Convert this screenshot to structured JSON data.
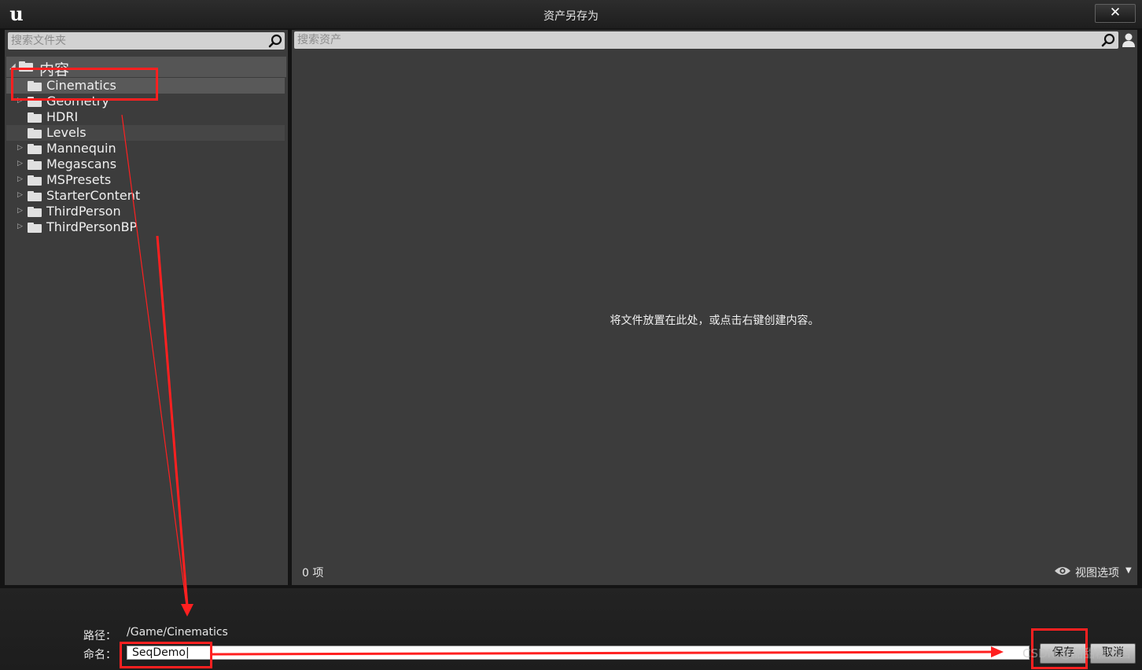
{
  "window": {
    "title": "资产另存为",
    "close_glyph": "✕",
    "logo_glyph": "u"
  },
  "left_panel": {
    "search_placeholder": "搜索文件夹",
    "root_label": "内容",
    "items": [
      {
        "label": "Cinematics",
        "has_children": false,
        "state": "selected"
      },
      {
        "label": "Geometry",
        "has_children": true,
        "state": "normal"
      },
      {
        "label": "HDRI",
        "has_children": false,
        "state": "normal"
      },
      {
        "label": "Levels",
        "has_children": false,
        "state": "hover"
      },
      {
        "label": "Mannequin",
        "has_children": true,
        "state": "normal"
      },
      {
        "label": "Megascans",
        "has_children": true,
        "state": "normal"
      },
      {
        "label": "MSPresets",
        "has_children": true,
        "state": "normal"
      },
      {
        "label": "StarterContent",
        "has_children": true,
        "state": "normal"
      },
      {
        "label": "ThirdPerson",
        "has_children": true,
        "state": "normal"
      },
      {
        "label": "ThirdPersonBP",
        "has_children": true,
        "state": "normal"
      }
    ]
  },
  "right_panel": {
    "search_placeholder": "搜索资产",
    "empty_message": "将文件放置在此处，或点击右键创建内容。",
    "item_count": "0 项",
    "view_options": "视图选项"
  },
  "bottom": {
    "path_label": "路径：",
    "path_value": "/Game/Cinematics",
    "name_label": "命名：",
    "name_value": "SeqDemo|",
    "save_label": "保存",
    "cancel_label": "取消"
  },
  "watermark": "CSDN @甜甜糕杰西",
  "colors": {
    "panel": "#3c3c3c",
    "selected": "#595959",
    "annotation": "#ff2020"
  },
  "icons": [
    "ue-logo-icon",
    "close-icon",
    "search-icon",
    "folder-icon",
    "expand-arrow-icon",
    "user-filter-icon",
    "eye-icon",
    "caret-down-icon"
  ]
}
